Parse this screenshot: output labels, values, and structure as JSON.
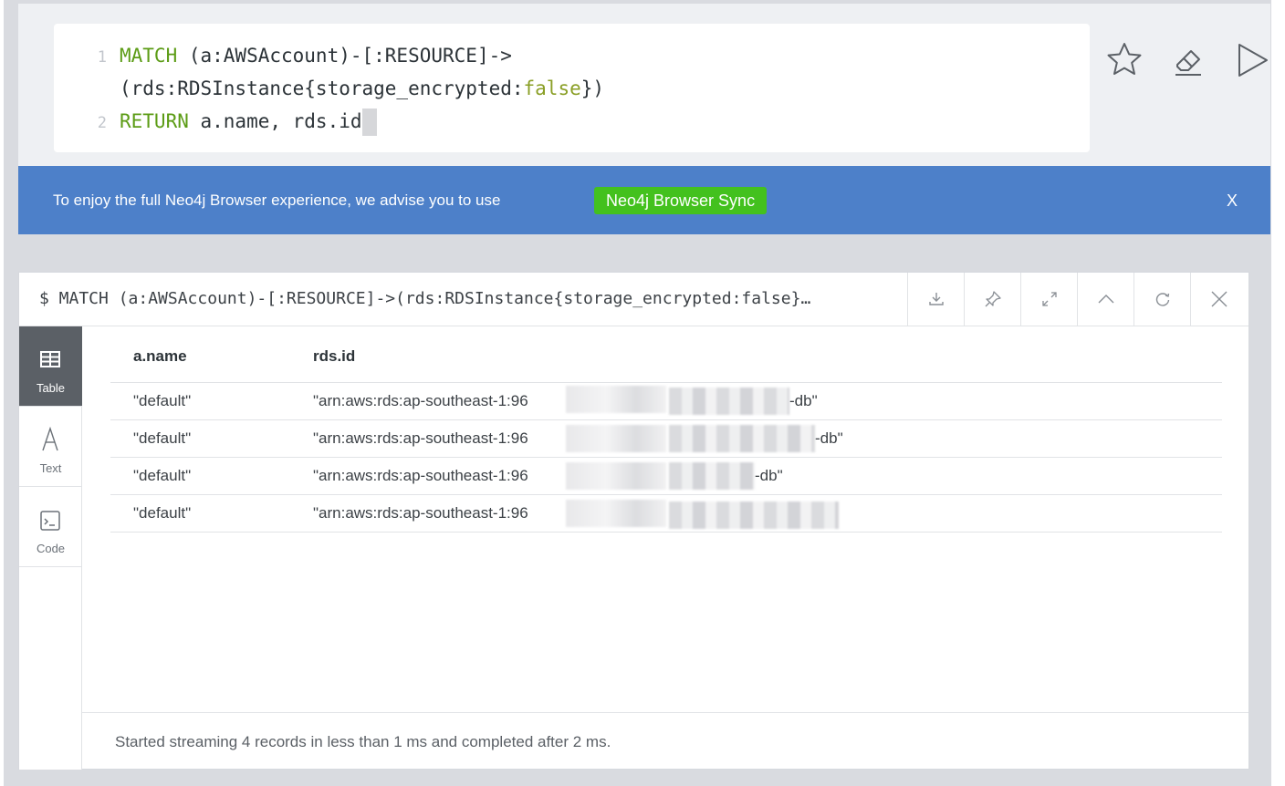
{
  "editor": {
    "line1_number": "1",
    "line1_kw": "MATCH",
    "line1_rest": " (a:AWSAccount)-[:RESOURCE]->",
    "line1b_pre": "(rds:RDSInstance{storage_encrypted:",
    "line1b_bool": "false",
    "line1b_post": "})",
    "line2_number": "2",
    "line2_kw": "RETURN",
    "line2_rest": " a.name, rds.id",
    "actions": [
      "star-icon",
      "eraser-icon",
      "play-icon"
    ]
  },
  "banner": {
    "text": "To enjoy the full Neo4j Browser experience, we advise you to use",
    "button_label": "Neo4j Browser Sync",
    "close_label": "X",
    "color": "#4d80c9",
    "button_color": "#43c11e"
  },
  "frame": {
    "title": "$ MATCH (a:AWSAccount)-[:RESOURCE]->(rds:RDSInstance{storage_encrypted:false}…",
    "buttons": [
      "download-icon",
      "pin-icon",
      "expand-icon",
      "collapse-icon",
      "rerun-icon",
      "close-icon"
    ],
    "sidebar": [
      {
        "label": "Table",
        "icon": "table-icon",
        "active": true
      },
      {
        "label": "Text",
        "icon": "text-icon",
        "active": false
      },
      {
        "label": "Code",
        "icon": "code-icon",
        "active": false
      }
    ],
    "table": {
      "headers": [
        "a.name",
        "rds.id"
      ],
      "rows": [
        {
          "name": "\"default\"",
          "id_prefix": "\"arn:aws:rds:ap-southeast-1:96",
          "id_suffix": "-db\""
        },
        {
          "name": "\"default\"",
          "id_prefix": "\"arn:aws:rds:ap-southeast-1:96",
          "id_suffix": "-db\""
        },
        {
          "name": "\"default\"",
          "id_prefix": "\"arn:aws:rds:ap-southeast-1:96",
          "id_suffix": "-db\""
        },
        {
          "name": "\"default\"",
          "id_prefix": "\"arn:aws:rds:ap-southeast-1:96",
          "id_suffix": ""
        }
      ]
    },
    "footer": "Started streaming 4 records in less than 1 ms and completed after 2 ms."
  }
}
